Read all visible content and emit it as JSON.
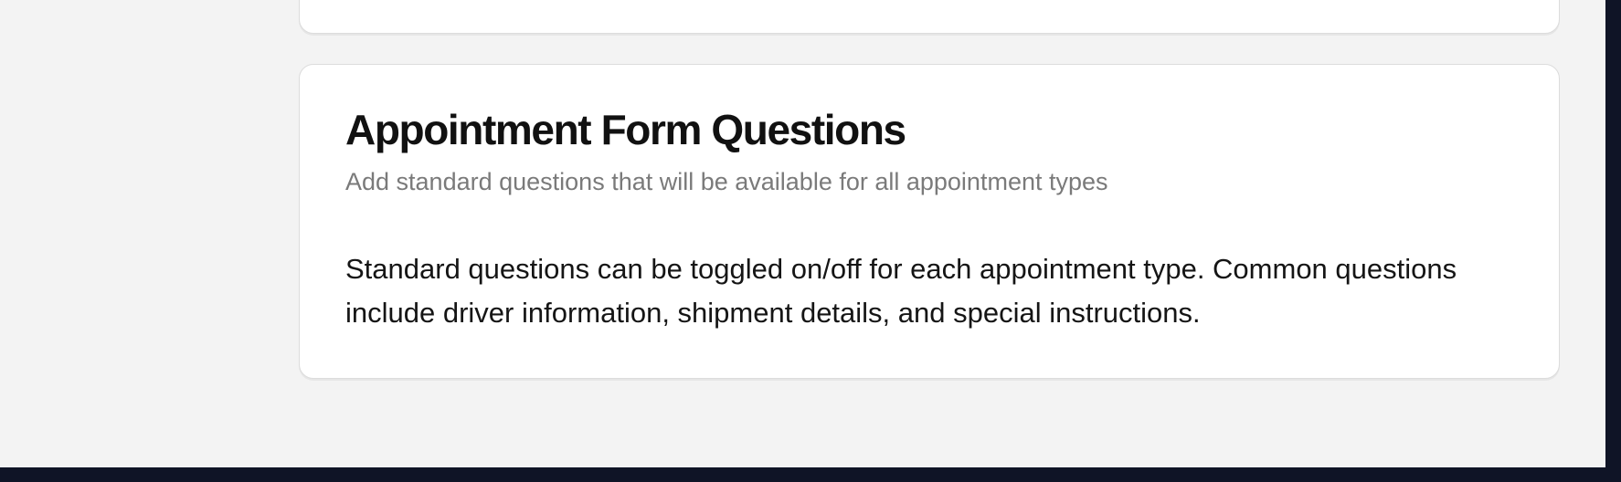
{
  "section": {
    "title": "Appointment Form Questions",
    "subtitle": "Add standard questions that will be available for all appointment types",
    "description": "Standard questions can be toggled on/off for each appointment type. Common questions include driver information, shipment details, and special instructions."
  }
}
